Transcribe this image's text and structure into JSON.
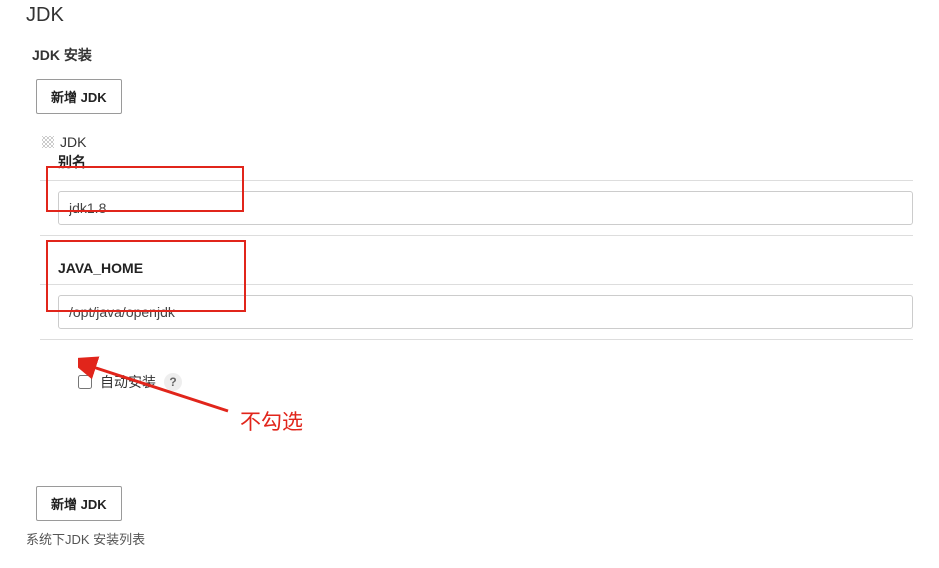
{
  "section": {
    "title": "JDK",
    "installTitle": "JDK 安装"
  },
  "buttons": {
    "addJdkTop": "新增 JDK",
    "addJdkBottom": "新增 JDK"
  },
  "tool": {
    "dragLabel": "JDK",
    "nameLabel": "别名",
    "nameValue": "jdk1.8",
    "javaHomeLabel": "JAVA_HOME",
    "javaHomeValue": "/opt/java/openjdk",
    "autoInstallLabel": "自动安装",
    "helpSymbol": "?"
  },
  "footer": {
    "helperText": "系统下JDK 安装列表"
  },
  "annotation": {
    "note": "不勾选"
  }
}
